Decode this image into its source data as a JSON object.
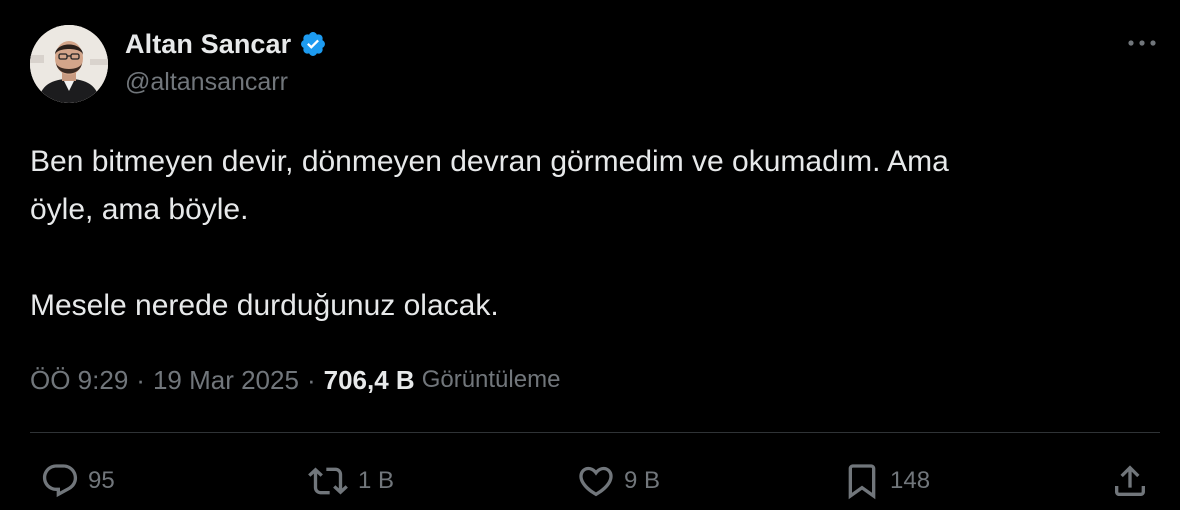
{
  "author": {
    "name": "Altan Sancar",
    "handle": "@altansancarr",
    "verified": true,
    "verified_color": "#1d9bf0",
    "avatar_icon": "profile-photo"
  },
  "tweet": {
    "lines": [
      "Ben bitmeyen devir, dönmeyen devran görmedim ve okumadım. Ama",
      "öyle, ama böyle.",
      "Mesele nerede durduğunuz olacak."
    ]
  },
  "meta": {
    "time": "ÖÖ 9:29",
    "separator": "·",
    "date": "19 Mar 2025",
    "views_count": "706,4 B",
    "views_label": "Görüntüleme"
  },
  "actions": {
    "reply_count": "95",
    "retweet_count": "1 B",
    "like_count": "9 B",
    "bookmark_count": "148",
    "icons": [
      "reply-icon",
      "retweet-icon",
      "like-icon",
      "bookmark-icon",
      "share-icon"
    ]
  },
  "colors": {
    "background": "#000000",
    "text": "#e7e9ea",
    "secondary": "#71767b",
    "divider": "#2f3336"
  }
}
